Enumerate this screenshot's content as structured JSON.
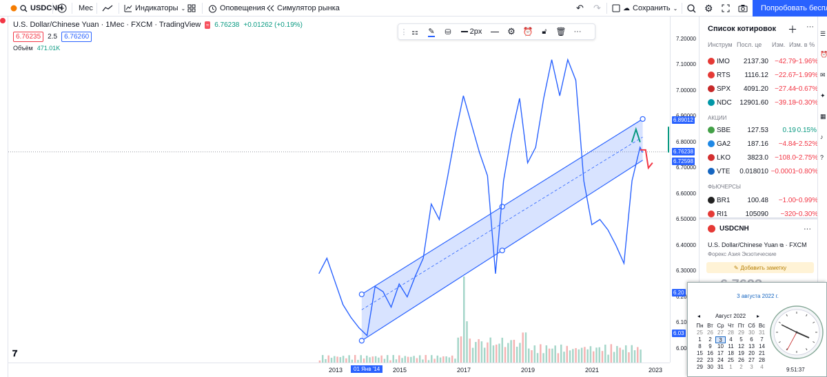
{
  "topbar": {
    "symbol": "USDCNH",
    "interval": "Мес",
    "indicators": "Индикаторы",
    "alerts": "Оповещения",
    "replay": "Симулятор рынка",
    "save": "Сохранить",
    "try_button": "Попробовать бесплат"
  },
  "legend": {
    "title": "U.S. Dollar/Chinese Yuan · 1Мес · FXCM · TradingView",
    "last": "6.76238",
    "change": "+0.01262 (+0.19%)",
    "bid": "6.76235",
    "spread": "2.5",
    "ask": "6.76260",
    "volume_label": "Объём",
    "volume_value": "471.01K"
  },
  "draw_toolbar": {
    "width_label": "2px"
  },
  "price_axis": {
    "labels": [
      "7.20000",
      "7.10000",
      "7.00000",
      "6.90000",
      "6.80000",
      "6.70000",
      "6.60000",
      "6.50000",
      "6.40000",
      "6.30000",
      "6.20000",
      "6.10000",
      "6.00000"
    ],
    "tag_top": "6.89012",
    "tag_last": "6.76238",
    "tag_low": "6.72598",
    "tag_mid": "6.20",
    "tag_bottom": "6.03"
  },
  "time_axis": {
    "labels": [
      "2013",
      "2015",
      "2017",
      "2019",
      "2021",
      "2023"
    ],
    "cursor_label": "01 Янв '14"
  },
  "chart_data": {
    "type": "line",
    "symbol": "USDCNH",
    "interval": "1Мес",
    "x": [
      "2012-07",
      "2012-10",
      "2013-01",
      "2013-04",
      "2013-07",
      "2013-10",
      "2014-01",
      "2014-04",
      "2014-07",
      "2014-10",
      "2015-01",
      "2015-04",
      "2015-07",
      "2015-10",
      "2016-01",
      "2016-04",
      "2016-07",
      "2016-10",
      "2017-01",
      "2017-04",
      "2017-07",
      "2017-10",
      "2018-01",
      "2018-04",
      "2018-07",
      "2018-10",
      "2019-01",
      "2019-04",
      "2019-07",
      "2019-10",
      "2020-01",
      "2020-04",
      "2020-07",
      "2020-10",
      "2021-01",
      "2021-04",
      "2021-07",
      "2021-10",
      "2022-01",
      "2022-04",
      "2022-07",
      "2022-08"
    ],
    "values": [
      6.29,
      6.35,
      6.26,
      6.17,
      6.12,
      6.08,
      6.05,
      6.24,
      6.22,
      6.16,
      6.25,
      6.2,
      6.28,
      6.35,
      6.56,
      6.5,
      6.66,
      6.83,
      6.98,
      6.87,
      6.76,
      6.67,
      6.29,
      6.65,
      6.83,
      6.97,
      6.72,
      6.78,
      6.97,
      7.12,
      6.98,
      7.12,
      7.04,
      6.65,
      6.48,
      6.5,
      6.46,
      6.4,
      6.33,
      6.65,
      6.78,
      6.76
    ],
    "ylim": [
      5.98,
      7.25
    ],
    "channel": {
      "start": "2013-11",
      "end": "2022-08",
      "mid_start": 6.15,
      "mid_end": 6.82,
      "upper_start": 6.21,
      "upper_end": 6.89,
      "lower_start": 6.03,
      "lower_end": 6.73
    },
    "volume_label": "Объём",
    "grid": false,
    "legend": "top-left"
  },
  "watchlist": {
    "title": "Список котировок",
    "columns": [
      "Инструм",
      "Посл. це",
      "Изм.",
      "Изм. в %"
    ],
    "indices": [
      {
        "sym": "IMO",
        "last": "2137.30",
        "chg": "−42.79",
        "pct": "−1.96%",
        "color": "#e53935"
      },
      {
        "sym": "RTS",
        "last": "1116.12",
        "chg": "−22.67",
        "pct": "−1.99%",
        "color": "#e53935"
      },
      {
        "sym": "SPX",
        "last": "4091.20",
        "chg": "−27.44",
        "pct": "−0.67%",
        "color": "#c62828"
      },
      {
        "sym": "NDC",
        "last": "12901.60",
        "chg": "−39.18",
        "pct": "−0.30%",
        "color": "#0097a7"
      }
    ],
    "stocks_label": "АКЦИИ",
    "stocks": [
      {
        "sym": "SBE",
        "last": "127.53",
        "chg": "0.19",
        "pct": "0.15%",
        "color": "#43a047"
      },
      {
        "sym": "GA2",
        "last": "187.16",
        "chg": "−4.84",
        "pct": "−2.52%",
        "color": "#1e88e5"
      },
      {
        "sym": "LKO",
        "last": "3823.0",
        "chg": "−108.0",
        "pct": "−2.75%",
        "color": "#d32f2f"
      },
      {
        "sym": "VTE",
        "last": "0.018010",
        "chg": "−0.0001",
        "pct": "−0.80%",
        "color": "#1565c0"
      }
    ],
    "futures_label": "ФЬЮЧЕРСЫ",
    "futures": [
      {
        "sym": "BR1",
        "last": "100.48",
        "chg": "−1.00",
        "pct": "−0.99%",
        "color": "#212121"
      },
      {
        "sym": "RI1",
        "last": "105090",
        "chg": "−320",
        "pct": "−0.30%",
        "color": "#e53935"
      }
    ],
    "detail": {
      "symbol": "USDCNH",
      "name": "U.S. Dollar/Chinese Yuan",
      "exchange": "FXCM",
      "category": "Форекс Азия Экзотические",
      "add_note": "Добавить заметку",
      "big_price": "6.7623"
    }
  },
  "calendar": {
    "date_long": "3 августа 2022 г.",
    "month": "Август 2022",
    "weekdays": [
      "Пн",
      "Вт",
      "Ср",
      "Чт",
      "Пт",
      "Сб",
      "Вс"
    ],
    "days": [
      "25",
      "26",
      "27",
      "28",
      "29",
      "30",
      "31",
      "1",
      "2",
      "3",
      "4",
      "5",
      "6",
      "7",
      "8",
      "9",
      "10",
      "11",
      "12",
      "13",
      "14",
      "15",
      "16",
      "17",
      "18",
      "19",
      "20",
      "21",
      "22",
      "23",
      "24",
      "25",
      "26",
      "27",
      "28",
      "29",
      "30",
      "31",
      "1",
      "2",
      "3",
      "4"
    ],
    "selected": "3",
    "time": "9:51:37"
  }
}
